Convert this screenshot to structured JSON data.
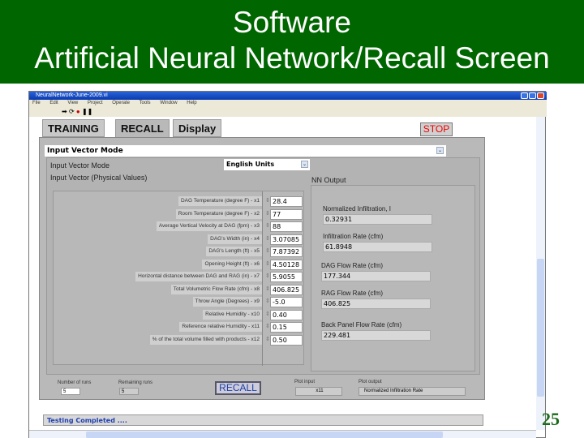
{
  "slide": {
    "title_line1": "Software",
    "title_line2": "Artificial Neural Network/Recall Screen",
    "page_number": "25"
  },
  "window": {
    "title": "NeuralNetwork-June-2009.vi",
    "menu": [
      "File",
      "Edit",
      "View",
      "Project",
      "Operate",
      "Tools",
      "Window",
      "Help"
    ]
  },
  "tabs": [
    "TRAINING",
    "RECALL",
    "Display"
  ],
  "active_tab": "RECALL",
  "stop_label": "STOP",
  "input_vector_mode_header": "Input Vector Mode",
  "input_vector_mode_label": "Input Vector Mode",
  "units_selected": "English Units",
  "input_vector_label": "Input Vector (Physical Values)",
  "inputs": [
    {
      "label": "DAG Temperature (degree F) - x1",
      "value": "28.4"
    },
    {
      "label": "Room Temperature (degree F) - x2",
      "value": "77"
    },
    {
      "label": "Average Vertical Velocity at DAG (fpm) - x3",
      "value": "88"
    },
    {
      "label": "DAG's Width (in) - x4",
      "value": "3.07085"
    },
    {
      "label": "DAG's Length (ft) - x5",
      "value": "7.87392"
    },
    {
      "label": "Opening Height (ft) - x6",
      "value": "4.50128"
    },
    {
      "label": "Horizontal distance between DAG and RAG (in) - x7",
      "value": "5.9055"
    },
    {
      "label": "Total Volumetric Flow Rate (cfm) - x8",
      "value": "406.825"
    },
    {
      "label": "Throw Angle (Degrees) - x9",
      "value": "-5.0"
    },
    {
      "label": "Relative Humidity - x10",
      "value": "0.40"
    },
    {
      "label": "Reference relative Humidity - x11",
      "value": "0.15"
    },
    {
      "label": "% of the total volume filled with products - x12",
      "value": "0.50"
    }
  ],
  "nn_output_label": "NN Output",
  "outputs": [
    {
      "label": "Normalized Infiltration, I",
      "value": "0.32931"
    },
    {
      "label": "Infiltration Rate (cfm)",
      "value": "61.8948"
    },
    {
      "label": "DAG Flow Rate (cfm)",
      "value": "177.344"
    },
    {
      "label": "RAG Flow Rate (cfm)",
      "value": "406.825"
    },
    {
      "label": "Back Panel Flow Rate (cfm)",
      "value": "229.481"
    }
  ],
  "bottom": {
    "runs_label": "Number of runs",
    "runs_value": "5",
    "remaining_label": "Remaining runs",
    "remaining_value": "5",
    "recall_label": "RECALL",
    "plot_input_label": "Plot input",
    "plot_input_value": "x11",
    "plot_output_label": "Plot output",
    "plot_output_value": "Normalized Infiltration Rate"
  },
  "status": "Testing Completed ...."
}
